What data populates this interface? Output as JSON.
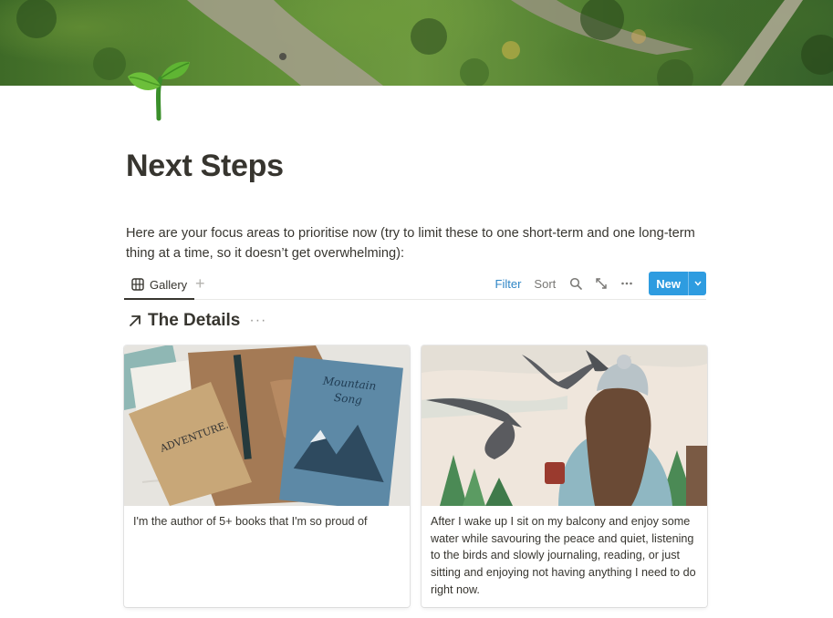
{
  "cover": {
    "image": "aerial-forest-trail"
  },
  "page": {
    "icon": "seedling-icon",
    "title": "Next Steps",
    "intro": "Here are your focus areas to prioritise now (try to limit these to one short-term and one long-term thing at a time, so it doesn’t get overwhelming):"
  },
  "database": {
    "views": [
      {
        "label": "Gallery",
        "icon": "gallery-icon"
      }
    ],
    "toolbar": {
      "filter": "Filter",
      "sort": "Sort",
      "search_icon": "search-icon",
      "expand_icon": "expand-icon",
      "more_icon": "more-icon",
      "new_label": "New"
    },
    "accent": "#2e9ce0",
    "section": {
      "title": "The Details",
      "more": "···"
    },
    "cards": [
      {
        "text": "I'm the author of 5+ books that I'm so proud of",
        "image": "notebooks-mountain-song"
      },
      {
        "text": "After I wake up I sit on my balcony and enjoy some water while savouring the peace and quiet, listening to the birds and slowly journaling, reading, or just sitting and enjoying not having anything I need to do right now.",
        "image": "watercolor-birds-woman"
      }
    ]
  }
}
